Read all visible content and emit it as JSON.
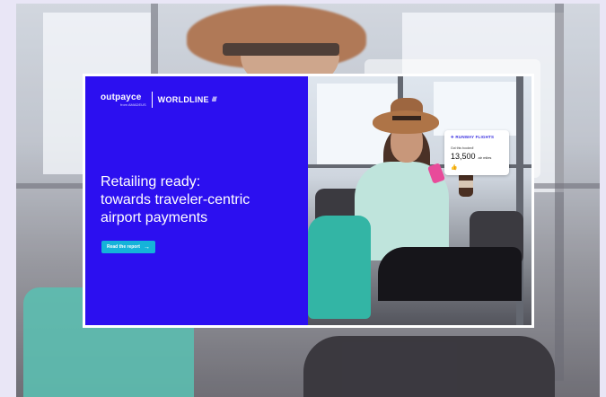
{
  "brand": {
    "outpayce": "outpayce",
    "outpayce_sub": "from AMADEUS",
    "worldline": "WORLDLINE",
    "worldline_mark": "/////"
  },
  "headline": {
    "line1": "Retailing ready:",
    "line2": "towards traveler-centric",
    "line3": "airport payments"
  },
  "cta": {
    "label": "Read the report",
    "arrow": "→"
  },
  "notification": {
    "brand": "RUNWAY FLIGHTS",
    "subtitle": "Got this booked!",
    "value": "13,500",
    "unit": "air miles",
    "icon": "thumbs-up-icon"
  },
  "colors": {
    "panel": "#2c0ff0",
    "cta": "#15b3d9",
    "card_border": "#ffffff"
  }
}
